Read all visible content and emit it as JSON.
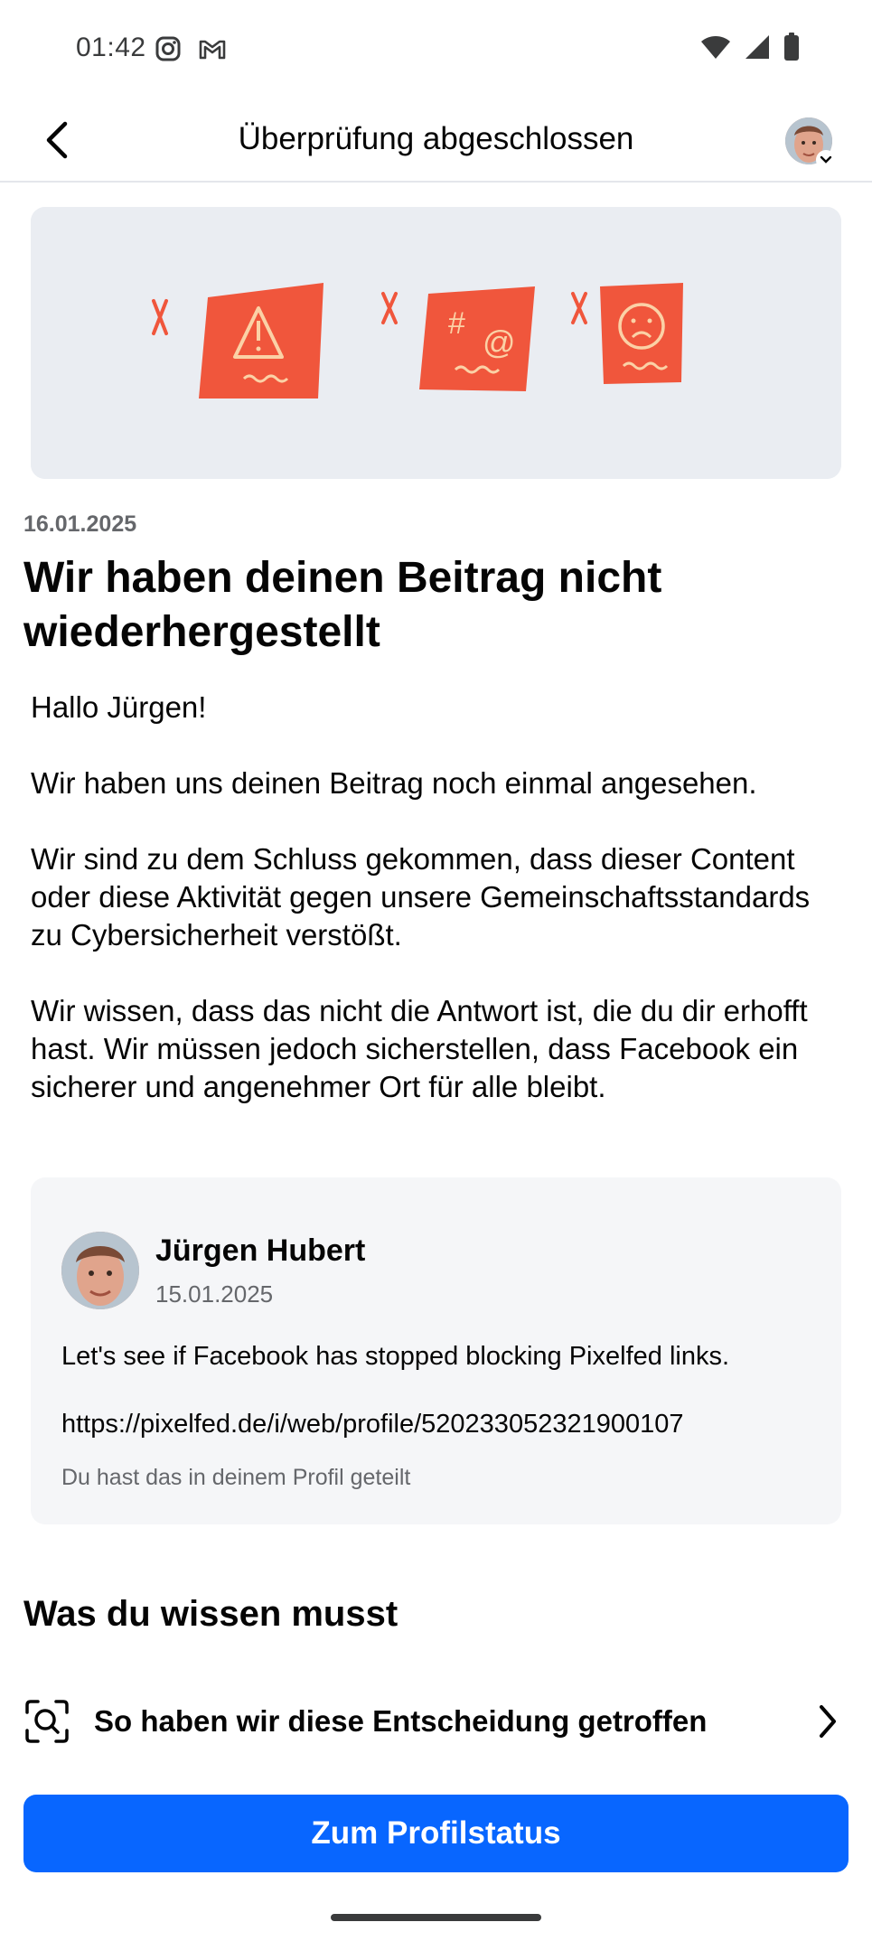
{
  "status_bar": {
    "time": "01:42",
    "icons_left": [
      "instagram-icon",
      "gmail-icon"
    ],
    "icons_right": [
      "wifi-icon",
      "signal-icon",
      "battery-icon"
    ]
  },
  "nav": {
    "title": "Überprüfung abgeschlossen",
    "back_icon": "back-arrow-icon",
    "profile_icon": "profile-avatar"
  },
  "notice": {
    "date": "16.01.2025",
    "headline": "Wir haben deinen Beitrag nicht wiederhergestellt",
    "greeting": "Hallo Jürgen!",
    "paragraph_1": "Wir haben uns deinen Beitrag noch einmal angesehen.",
    "paragraph_2": "Wir sind zu dem Schluss gekommen, dass dieser Content oder diese Aktivität gegen unsere Gemeinschaftsstandards zu Cybersicherheit verstößt.",
    "paragraph_3": "Wir wissen, dass das nicht die Antwort ist, die du dir erhofft hast. Wir müssen jedoch sicherstellen, dass Facebook ein sicherer und angenehmer Ort für alle bleibt."
  },
  "post": {
    "author": "Jürgen Hubert",
    "date": "15.01.2025",
    "text": "Let's see if Facebook has stopped blocking Pixelfed links.",
    "link": "https://pixelfed.de/i/web/profile/520233052321900107",
    "shared_note": "Du hast das in deinem Profil geteilt"
  },
  "info_section": {
    "heading": "Was du wissen musst",
    "decision_label": "So haben wir diese Entscheidung getroffen",
    "decision_icon": "search-scan-icon",
    "chevron_icon": "chevron-right-icon"
  },
  "cta": {
    "label": "Zum Profilstatus"
  },
  "colors": {
    "primary": "#0866ff",
    "card_bg": "#f5f6f8",
    "hero_bg": "#e9ecf2",
    "sticker": "#f0563c",
    "secondary_text": "#65676b"
  }
}
